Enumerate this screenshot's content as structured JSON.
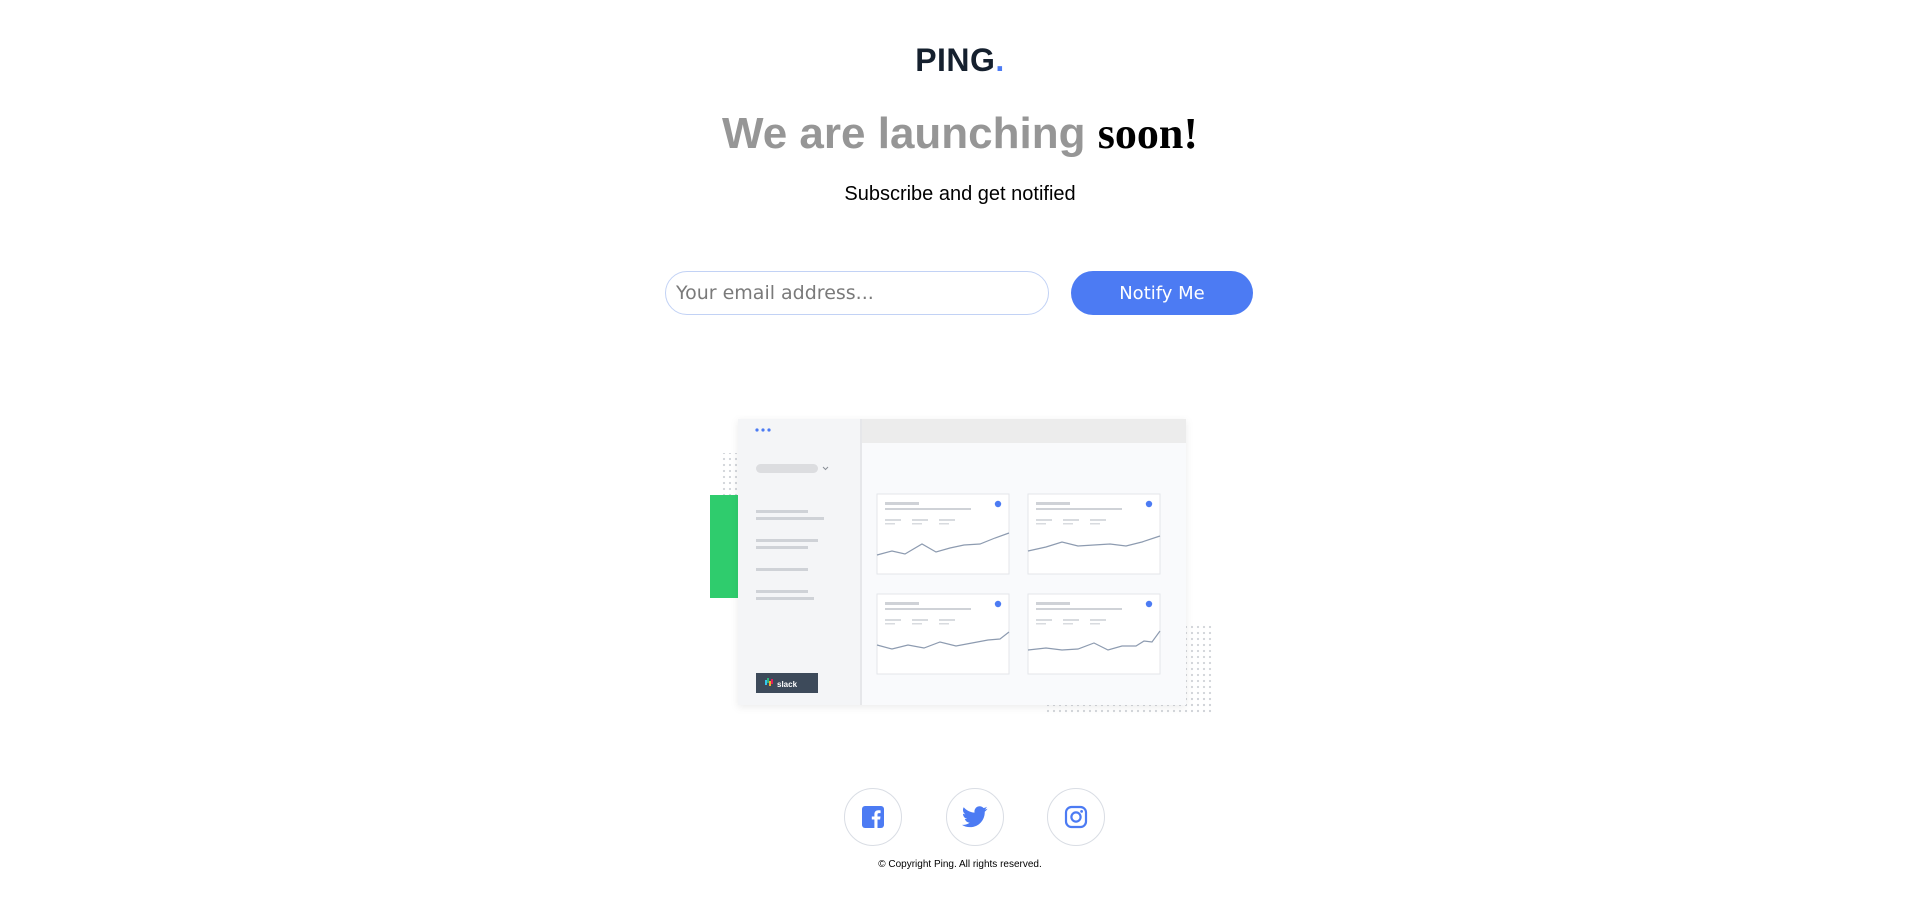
{
  "brand": {
    "name": "PING",
    "dot": "."
  },
  "hero": {
    "title_light": "We are launching",
    "title_strong": "soon!",
    "subtitle": "Subscribe and get notified"
  },
  "form": {
    "email_placeholder": "Your email address...",
    "email_value": "",
    "submit_label": "Notify Me"
  },
  "illustration": {
    "sidebar_button_label": "slack"
  },
  "social": [
    {
      "name": "facebook-icon"
    },
    {
      "name": "twitter-icon"
    },
    {
      "name": "instagram-icon"
    }
  ],
  "footer": {
    "copyright": "© Copyright Ping. All rights reserved."
  },
  "colors": {
    "accent": "#4c7bf3",
    "heading_light": "#969696",
    "brand_dark": "#15202e",
    "green": "#2fcc6d"
  }
}
